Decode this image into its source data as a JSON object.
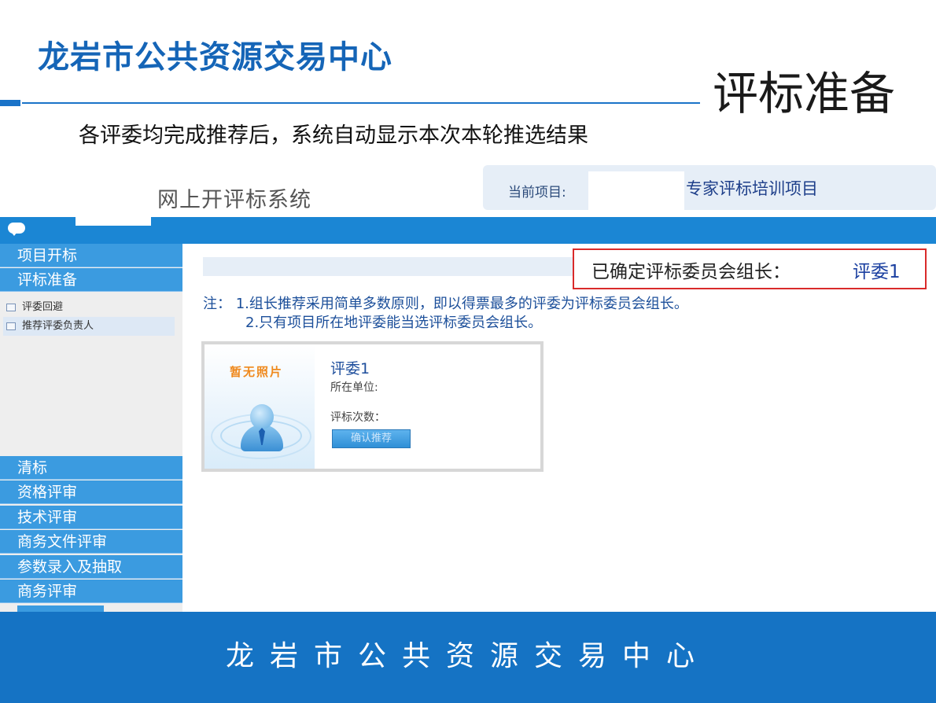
{
  "slide": {
    "title": "龙岩市公共资源交易中心",
    "section": "评标准备",
    "subtitle": "各评委均完成推荐后，系统自动显示本次本轮推选结果",
    "footer": "龙岩市公共资源交易中心"
  },
  "app": {
    "name": "网上开评标系统",
    "project_label": "当前项目:",
    "project_name": "专家评标培训项目"
  },
  "sidebar": {
    "top_items": [
      "项目开标",
      "评标准备"
    ],
    "sub_items": [
      "评委回避",
      "推荐评委负责人"
    ],
    "bottom_items": [
      "清标",
      "资格评审",
      "技术评审",
      "商务文件评审",
      "参数录入及抽取",
      "商务评审"
    ]
  },
  "main": {
    "leader_label": "已确定评标委员会组长：",
    "leader_name": "评委1",
    "note1": "注：  1.组长推荐采用简单多数原则，即以得票最多的评委为评标委员会组长。",
    "note2": "2.只有项目所在地评委能当选评标委员会组长。",
    "card": {
      "no_photo": "暂无照片",
      "name": "评委1",
      "unit_label": "所在单位:",
      "count_label": "评标次数：",
      "button": "确认推荐"
    }
  },
  "colors": {
    "brand_blue": "#1573c4",
    "nav_blue": "#3b9be0",
    "highlight_red": "#d92a2a"
  },
  "icons": [
    "chat-icon",
    "document-icon",
    "person-avatar-icon"
  ]
}
